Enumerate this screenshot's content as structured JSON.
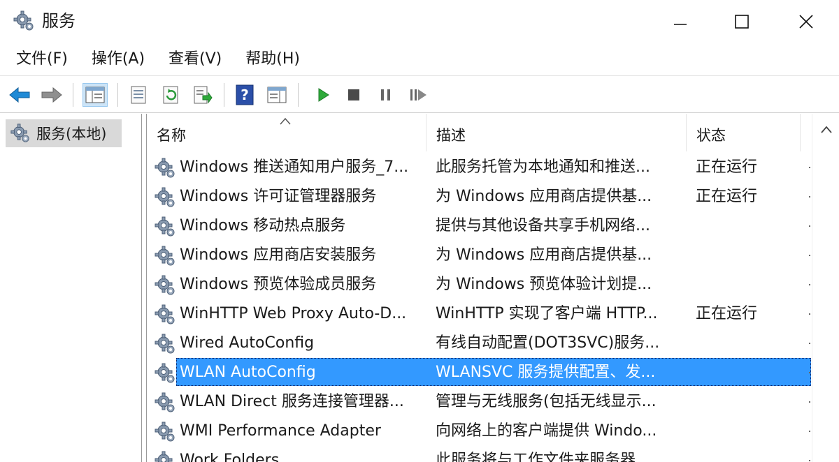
{
  "window": {
    "title": "服务"
  },
  "menu": [
    "文件(F)",
    "操作(A)",
    "查看(V)",
    "帮助(H)"
  ],
  "toolbar": {
    "buttons": [
      "back-icon",
      "forward-icon",
      "show-hide-console-tree-icon",
      "properties-icon",
      "refresh-icon",
      "export-list-icon",
      "help-icon",
      "show-action-pane-icon",
      "start-service-icon",
      "stop-service-icon",
      "pause-service-icon",
      "restart-service-icon"
    ]
  },
  "tree": {
    "root_label": "服务(本地)"
  },
  "list": {
    "columns": {
      "name": "名称",
      "description": "描述",
      "status": "状态"
    },
    "rows": [
      {
        "name": "Windows 推送通知用户服务_7...",
        "description": "此服务托管为本地通知和推送...",
        "status": "正在运行"
      },
      {
        "name": "Windows 许可证管理器服务",
        "description": "为 Windows 应用商店提供基...",
        "status": "正在运行"
      },
      {
        "name": "Windows 移动热点服务",
        "description": "提供与其他设备共享手机网络...",
        "status": ""
      },
      {
        "name": "Windows 应用商店安装服务",
        "description": "为 Windows 应用商店提供基...",
        "status": ""
      },
      {
        "name": "Windows 预览体验成员服务",
        "description": "为 Windows 预览体验计划提...",
        "status": ""
      },
      {
        "name": "WinHTTP Web Proxy Auto-D...",
        "description": "WinHTTP 实现了客户端 HTTP...",
        "status": "正在运行"
      },
      {
        "name": "Wired AutoConfig",
        "description": "有线自动配置(DOT3SVC)服务...",
        "status": ""
      },
      {
        "name": "WLAN AutoConfig",
        "description": "WLANSVC 服务提供配置、发...",
        "status": ""
      },
      {
        "name": "WLAN Direct 服务连接管理器...",
        "description": "管理与无线服务(包括无线显示...",
        "status": ""
      },
      {
        "name": "WMI Performance Adapter",
        "description": "向网络上的客户端提供 Windo...",
        "status": ""
      },
      {
        "name": "Work Folders",
        "description": "此服务将与工作文件夹服务器...",
        "status": ""
      }
    ],
    "selected_index": 7
  },
  "colors": {
    "selection": "#3399ff",
    "toolbar_active": "#cce4f7",
    "start_green": "#2eaa3a"
  }
}
